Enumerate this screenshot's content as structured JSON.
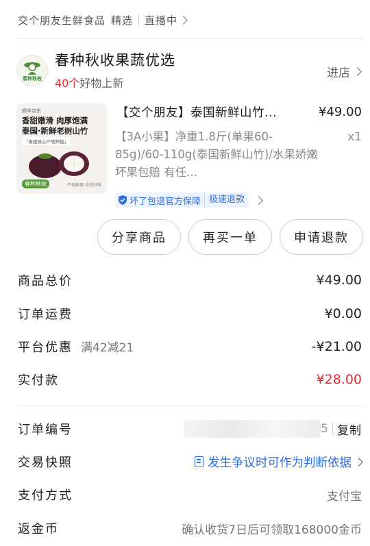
{
  "breadcrumb": {
    "source": "交个朋友生鲜食品",
    "tag": "精选",
    "live": "直播中"
  },
  "shop": {
    "logo_text": "春种秋收",
    "name": "春种秋收果蔬优选",
    "new_count": "40个",
    "new_label": "好物上新",
    "enter_label": "进店"
  },
  "product": {
    "image": {
      "brand": "顺丰京东",
      "line1": "香甜嫩滑 肉厚饱满",
      "line2": "泰国·新鲜老树山竹",
      "line3": "「泰国核心产地种植」",
      "logo": "春种秋收",
      "tags": "产地鲜果  自然好味"
    },
    "title": "【交个朋友】泰国新鲜山竹...",
    "price": "¥49.00",
    "desc": "【3A小果】净重1.8斤(单果60-85g)/60-110g(泰国新鲜山竹)/水果娇嫩 坏果包赔 有任...",
    "qty": "x1",
    "guarantee": "坏了包退官方保障",
    "fast_refund": "极速退款"
  },
  "actions": {
    "share": "分享商品",
    "rebuy": "再买一单",
    "refund": "申请退款"
  },
  "summary": {
    "total_label": "商品总价",
    "total_value": "¥49.00",
    "shipping_label": "订单运费",
    "shipping_value": "¥0.00",
    "discount_label": "平台优惠",
    "discount_note": "满42减21",
    "discount_value": "-¥21.00",
    "paid_label": "实付款",
    "paid_value": "¥28.00"
  },
  "details": {
    "order_no_label": "订单编号",
    "order_no_tail": "5",
    "copy_label": "复制",
    "snapshot_label": "交易快照",
    "snapshot_value": "发生争议时可作为判断依据",
    "payment_label": "支付方式",
    "payment_value": "支付宝",
    "coins_label": "返金币",
    "coins_value": "确认收货7日后可领取168000金币"
  },
  "colors": {
    "accent_red": "#e12d2d",
    "link_blue": "#2f6fe0",
    "border_gray": "#cfcfcf"
  }
}
